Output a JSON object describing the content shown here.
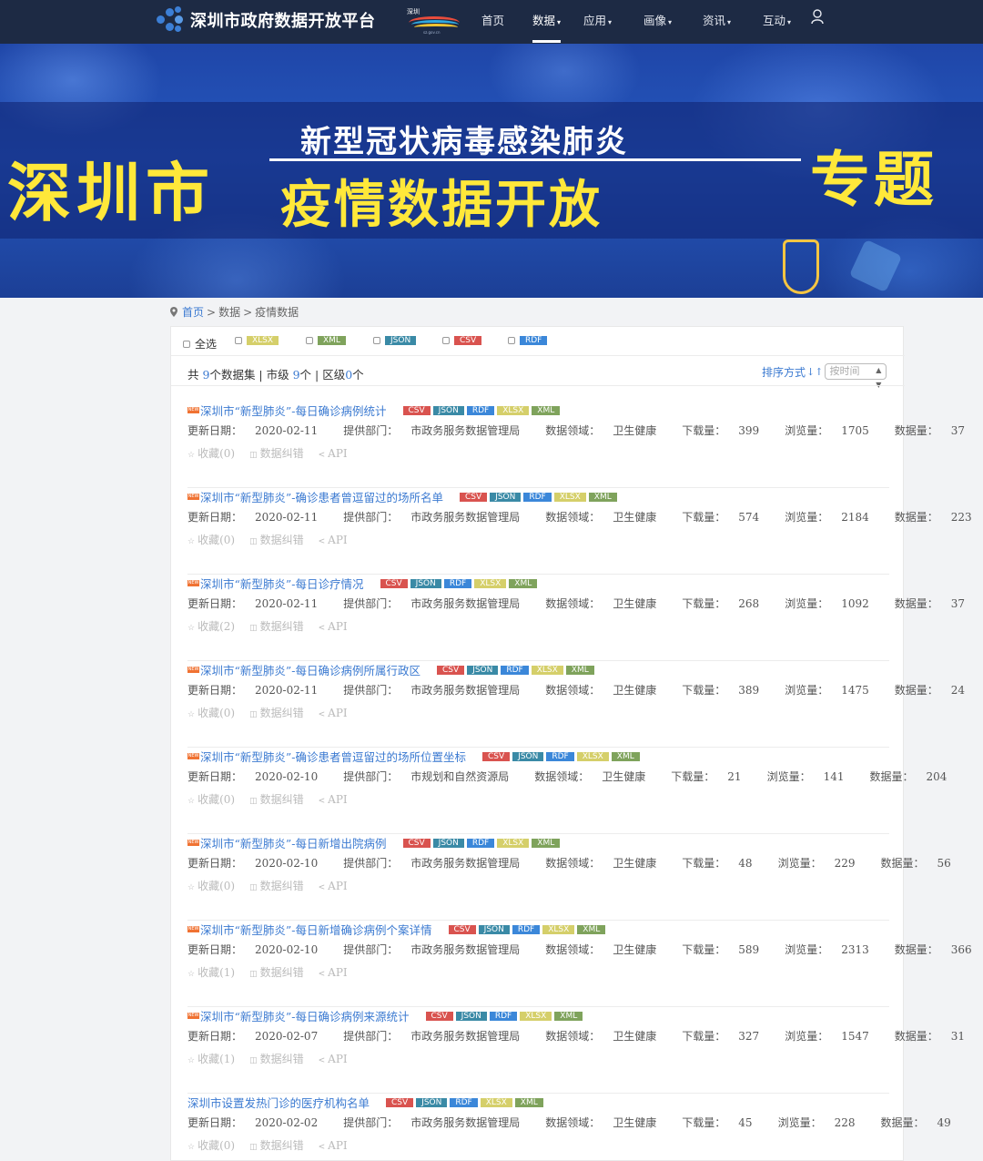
{
  "site": {
    "title": "深圳市政府数据开放平台"
  },
  "nav": [
    {
      "label": "首页",
      "dropdown": false,
      "active": false
    },
    {
      "label": "数据",
      "dropdown": true,
      "active": true
    },
    {
      "label": "应用",
      "dropdown": true,
      "active": false
    },
    {
      "label": "画像",
      "dropdown": true,
      "active": false
    },
    {
      "label": "资讯",
      "dropdown": true,
      "active": false
    },
    {
      "label": "互动",
      "dropdown": true,
      "active": false
    }
  ],
  "banner": {
    "subtitle": "新型冠状病毒感染肺炎",
    "city": "深圳市",
    "main": "疫情数据开放",
    "topic": "专题"
  },
  "breadcrumb": {
    "home": "首页",
    "sep": ">",
    "level2": "数据",
    "level3": "疫情数据"
  },
  "filters": {
    "select_all": "全选",
    "formats": [
      "XLSX",
      "XML",
      "JSON",
      "CSV",
      "RDF"
    ]
  },
  "summary": {
    "p1": "共 ",
    "total": "9",
    "p2": "个数据集 | 市级 ",
    "city": "9",
    "p3": "个 | 区级",
    "district": "0",
    "p4": "个"
  },
  "sort": {
    "label": "排序方式",
    "value": "按时间"
  },
  "labels": {
    "date": "更新日期：",
    "dept": "提供部门：",
    "field": "数据领域：",
    "downloads": "下载量：",
    "views": "浏览量：",
    "count": "数据量：",
    "collect": "收藏",
    "report": "数据纠错",
    "api": "API",
    "new_badge": "NEW"
  },
  "datasets": [
    {
      "title": "深圳市“新型肺炎”-每日确诊病例统计",
      "is_new": true,
      "formats": [
        "CSV",
        "JSON",
        "RDF",
        "XLSX",
        "XML"
      ],
      "date": "2020-02-11",
      "dept": "市政务服务数据管理局",
      "field": "卫生健康",
      "downloads": "399",
      "views": "1705",
      "count": "37",
      "favorites": "(0)"
    },
    {
      "title": "深圳市“新型肺炎”-确诊患者曾逗留过的场所名单",
      "is_new": true,
      "formats": [
        "CSV",
        "JSON",
        "RDF",
        "XLSX",
        "XML"
      ],
      "date": "2020-02-11",
      "dept": "市政务服务数据管理局",
      "field": "卫生健康",
      "downloads": "574",
      "views": "2184",
      "count": "223",
      "favorites": "(0)"
    },
    {
      "title": "深圳市“新型肺炎”-每日诊疗情况",
      "is_new": true,
      "formats": [
        "CSV",
        "JSON",
        "RDF",
        "XLSX",
        "XML"
      ],
      "date": "2020-02-11",
      "dept": "市政务服务数据管理局",
      "field": "卫生健康",
      "downloads": "268",
      "views": "1092",
      "count": "37",
      "favorites": "(2)"
    },
    {
      "title": "深圳市“新型肺炎”-每日确诊病例所属行政区",
      "is_new": true,
      "formats": [
        "CSV",
        "JSON",
        "RDF",
        "XLSX",
        "XML"
      ],
      "date": "2020-02-11",
      "dept": "市政务服务数据管理局",
      "field": "卫生健康",
      "downloads": "389",
      "views": "1475",
      "count": "24",
      "favorites": "(0)"
    },
    {
      "title": "深圳市“新型肺炎”-确诊患者曾逗留过的场所位置坐标",
      "is_new": true,
      "formats": [
        "CSV",
        "JSON",
        "RDF",
        "XLSX",
        "XML"
      ],
      "date": "2020-02-10",
      "dept": "市规划和自然资源局",
      "field": "卫生健康",
      "downloads": "21",
      "views": "141",
      "count": "204",
      "favorites": "(0)"
    },
    {
      "title": "深圳市“新型肺炎”-每日新增出院病例",
      "is_new": true,
      "formats": [
        "CSV",
        "JSON",
        "RDF",
        "XLSX",
        "XML"
      ],
      "date": "2020-02-10",
      "dept": "市政务服务数据管理局",
      "field": "卫生健康",
      "downloads": "48",
      "views": "229",
      "count": "56",
      "favorites": "(0)"
    },
    {
      "title": "深圳市“新型肺炎”-每日新增确诊病例个案详情",
      "is_new": true,
      "formats": [
        "CSV",
        "JSON",
        "RDF",
        "XLSX",
        "XML"
      ],
      "date": "2020-02-10",
      "dept": "市政务服务数据管理局",
      "field": "卫生健康",
      "downloads": "589",
      "views": "2313",
      "count": "366",
      "favorites": "(1)"
    },
    {
      "title": "深圳市“新型肺炎”-每日确诊病例来源统计",
      "is_new": true,
      "formats": [
        "CSV",
        "JSON",
        "RDF",
        "XLSX",
        "XML"
      ],
      "date": "2020-02-07",
      "dept": "市政务服务数据管理局",
      "field": "卫生健康",
      "downloads": "327",
      "views": "1547",
      "count": "31",
      "favorites": "(1)"
    },
    {
      "title": "深圳市设置发热门诊的医疗机构名单",
      "is_new": false,
      "formats": [
        "CSV",
        "JSON",
        "RDF",
        "XLSX",
        "XML"
      ],
      "date": "2020-02-02",
      "dept": "市政务服务数据管理局",
      "field": "卫生健康",
      "downloads": "45",
      "views": "228",
      "count": "49",
      "favorites": "(0)"
    }
  ]
}
